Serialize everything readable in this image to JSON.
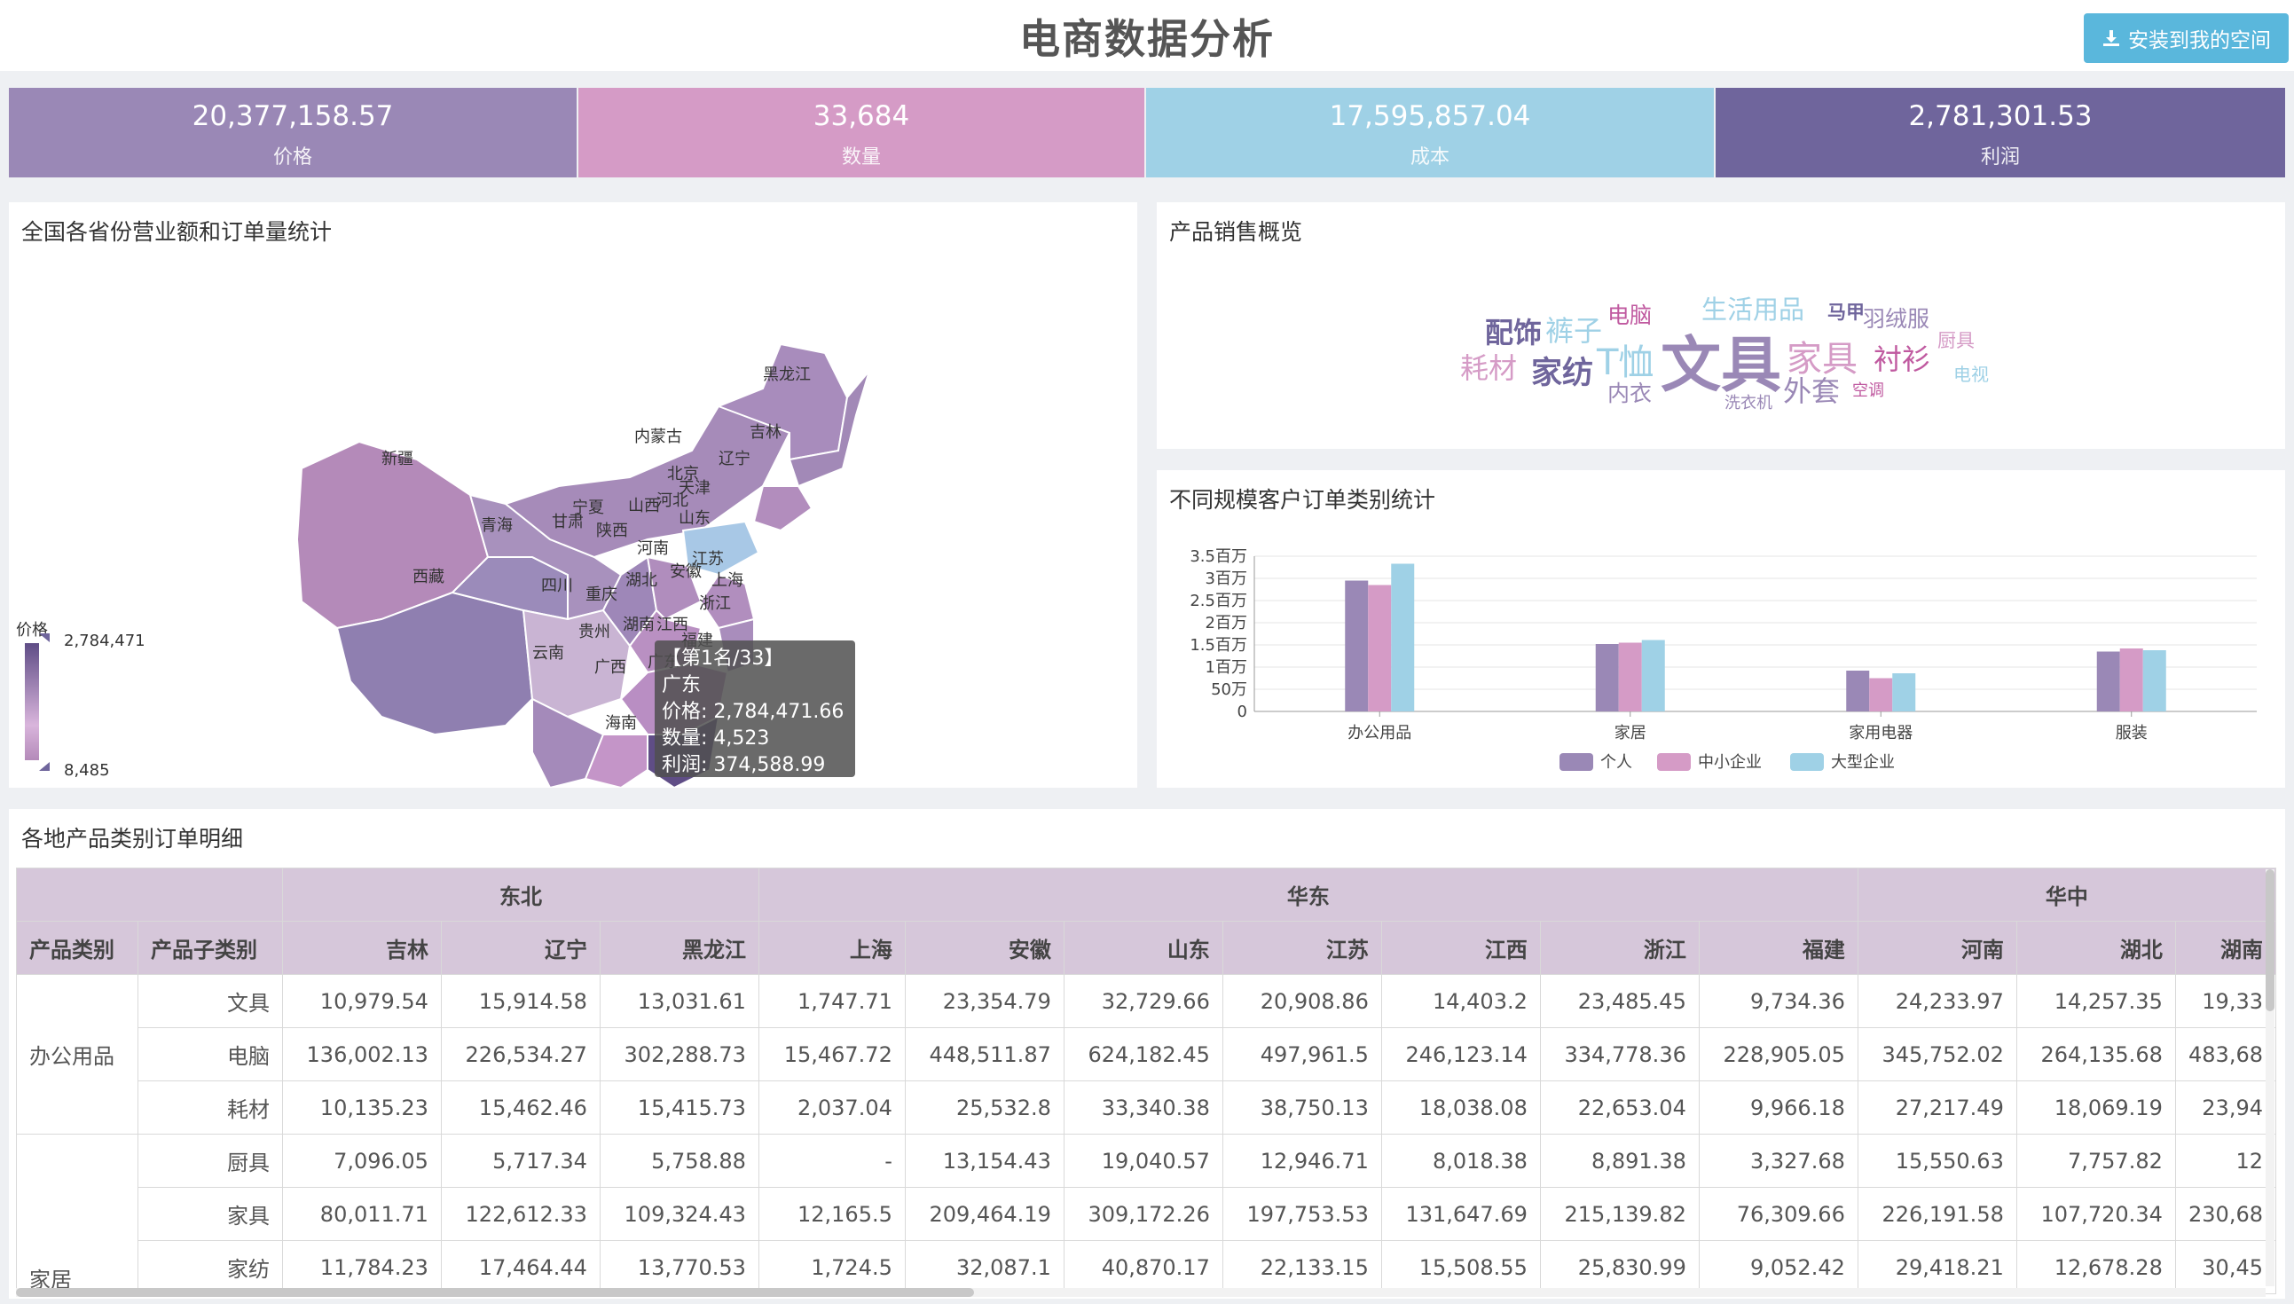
{
  "header": {
    "title": "电商数据分析",
    "install_label": "安装到我的空间"
  },
  "kpis": [
    {
      "value": "20,377,158.57",
      "label": "价格",
      "color": "#9a88b6"
    },
    {
      "value": "33,684",
      "label": "数量",
      "color": "#d59bc6"
    },
    {
      "value": "17,595,857.04",
      "label": "成本",
      "color": "#9fd1e6"
    },
    {
      "value": "2,781,301.53",
      "label": "利润",
      "color": "#6f659c"
    }
  ],
  "map_panel": {
    "title": "全国各省份营业额和订单量统计",
    "legend_title": "价格",
    "legend_max": "2,784,471",
    "legend_min": "8,485",
    "provinces": [
      "黑龙江",
      "吉林",
      "内蒙古",
      "辽宁",
      "新疆",
      "北京",
      "天津",
      "河北",
      "山西",
      "宁夏",
      "甘肃",
      "青海",
      "山东",
      "陕西",
      "河南",
      "江苏",
      "西藏",
      "安徽",
      "上海",
      "四川",
      "湖北",
      "重庆",
      "浙江",
      "贵州",
      "湖南",
      "江西",
      "福建",
      "云南",
      "广西",
      "广东",
      "海南"
    ],
    "tooltip": {
      "rank": "【第1名/33】",
      "province": "广东",
      "price": "价格: 2,784,471.66",
      "qty": "数量: 4,523",
      "profit": "利润: 374,588.99"
    }
  },
  "wordcloud_panel": {
    "title": "产品销售概览",
    "words": [
      {
        "text": "配饰",
        "color": "#6f659c"
      },
      {
        "text": "裤子",
        "color": "#9fd1e6"
      },
      {
        "text": "电脑",
        "color": "#c05aa0"
      },
      {
        "text": "生活用品",
        "color": "#9fd1e6"
      },
      {
        "text": "马甲",
        "color": "#6f659c"
      },
      {
        "text": "羽绒服",
        "color": "#9a88b6"
      },
      {
        "text": "耗材",
        "color": "#d59bc6"
      },
      {
        "text": "家纺",
        "color": "#6f659c"
      },
      {
        "text": "T恤",
        "color": "#9fd1e6"
      },
      {
        "text": "文具",
        "color": "#9a88b6"
      },
      {
        "text": "家具",
        "color": "#d59bc6"
      },
      {
        "text": "衬衫",
        "color": "#c05aa0"
      },
      {
        "text": "厨具",
        "color": "#d59bc6"
      },
      {
        "text": "内衣",
        "color": "#9a88b6"
      },
      {
        "text": "洗衣机",
        "color": "#9a88b6"
      },
      {
        "text": "外套",
        "color": "#9a88b6"
      },
      {
        "text": "空调",
        "color": "#c05aa0"
      },
      {
        "text": "电视",
        "color": "#9fd1e6"
      }
    ]
  },
  "bar_panel": {
    "title": "不同规模客户订单类别统计"
  },
  "chart_data": {
    "type": "bar",
    "categories": [
      "办公用品",
      "家居",
      "家用电器",
      "服装"
    ],
    "series": [
      {
        "name": "个人",
        "color": "#9a88b6",
        "values": [
          2950000,
          1520000,
          920000,
          1350000
        ]
      },
      {
        "name": "中小企业",
        "color": "#d59bc6",
        "values": [
          2850000,
          1550000,
          750000,
          1420000
        ]
      },
      {
        "name": "大型企业",
        "color": "#9fd1e6",
        "values": [
          3330000,
          1610000,
          860000,
          1380000
        ]
      }
    ],
    "yticks": [
      "0",
      "50万",
      "1百万",
      "1.5百万",
      "2百万",
      "2.5百万",
      "3百万",
      "3.5百万"
    ],
    "ylim": [
      0,
      3500000
    ],
    "legend_position": "bottom",
    "grid": true
  },
  "table_panel": {
    "title": "各地产品类别订单明细",
    "regions": [
      {
        "name": "东北",
        "span": 3
      },
      {
        "name": "华东",
        "span": 7
      },
      {
        "name": "华中",
        "span": 3
      }
    ],
    "headers": [
      "产品类别",
      "产品子类别",
      "吉林",
      "辽宁",
      "黑龙江",
      "上海",
      "安徽",
      "山东",
      "江苏",
      "江西",
      "浙江",
      "福建",
      "河南",
      "湖北",
      "湖南"
    ],
    "groups": [
      {
        "category": "办公用品",
        "rows": [
          {
            "sub": "文具",
            "cells": [
              "10,979.54",
              "15,914.58",
              "13,031.61",
              "1,747.71",
              "23,354.79",
              "32,729.66",
              "20,908.86",
              "14,403.2",
              "23,485.45",
              "9,734.36",
              "24,233.97",
              "14,257.35",
              "19,33"
            ]
          },
          {
            "sub": "电脑",
            "cells": [
              "136,002.13",
              "226,534.27",
              "302,288.73",
              "15,467.72",
              "448,511.87",
              "624,182.45",
              "497,961.5",
              "246,123.14",
              "334,778.36",
              "228,905.05",
              "345,752.02",
              "264,135.68",
              "483,68"
            ]
          },
          {
            "sub": "耗材",
            "cells": [
              "10,135.23",
              "15,462.46",
              "15,415.73",
              "2,037.04",
              "25,532.8",
              "33,340.38",
              "38,750.13",
              "18,038.08",
              "22,653.04",
              "9,966.18",
              "27,217.49",
              "18,069.19",
              "23,94"
            ]
          }
        ]
      },
      {
        "category": "家居",
        "rows": [
          {
            "sub": "厨具",
            "cells": [
              "7,096.05",
              "5,717.34",
              "5,758.88",
              "-",
              "13,154.43",
              "19,040.57",
              "12,946.71",
              "8,018.38",
              "8,891.38",
              "3,327.68",
              "15,550.63",
              "7,757.82",
              "12"
            ]
          },
          {
            "sub": "家具",
            "cells": [
              "80,011.71",
              "122,612.33",
              "109,324.43",
              "12,165.5",
              "209,464.19",
              "309,172.26",
              "197,753.53",
              "131,647.69",
              "215,139.82",
              "76,309.66",
              "226,191.58",
              "107,720.34",
              "230,68"
            ]
          },
          {
            "sub": "家纺",
            "cells": [
              "11,784.23",
              "17,464.44",
              "13,770.53",
              "1,724.5",
              "32,087.1",
              "40,870.17",
              "22,133.15",
              "15,508.55",
              "25,830.99",
              "9,052.42",
              "29,418.21",
              "12,678.28",
              "30,45"
            ]
          }
        ]
      }
    ]
  }
}
